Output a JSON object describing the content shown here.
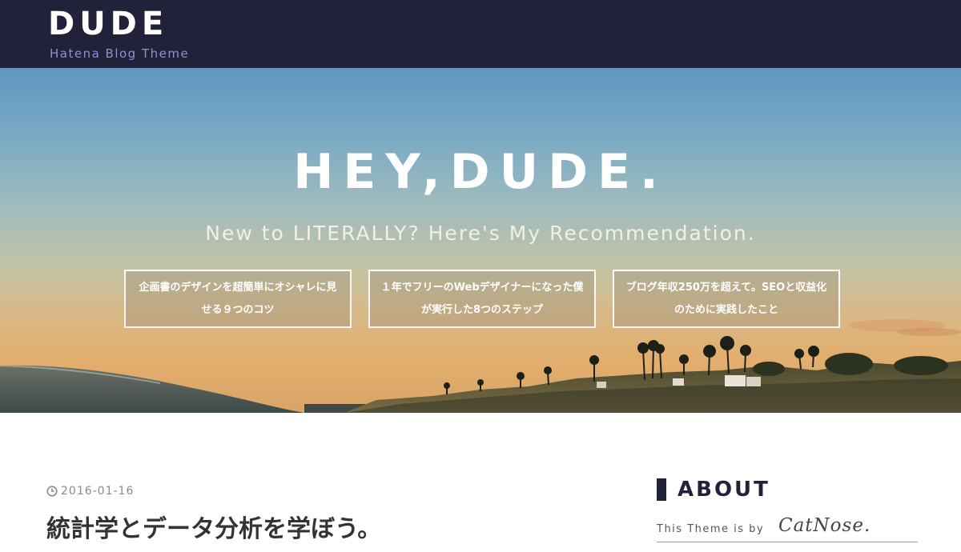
{
  "header": {
    "title": "DUDE",
    "subtitle": "Hatena Blog Theme"
  },
  "hero": {
    "title": "HEY,DUDE.",
    "subtitle": "New to LITERALLY? Here's My Recommendation.",
    "cards": [
      {
        "label": "企画書のデザインを超簡単にオシャレに見せる９つのコツ"
      },
      {
        "label": "１年でフリーのWebデザイナーになった僕が実行した8つのステップ"
      },
      {
        "label": "ブログ年収250万を超えて。SEOと収益化のために実践したこと"
      }
    ]
  },
  "post": {
    "date": "2016-01-16",
    "date_icon": "clock-icon",
    "title": "統計学とデータ分析を学ぼう。"
  },
  "sidebar": {
    "about_title": "ABOUT",
    "credit_text": "This Theme is by",
    "credit_author": "CatNose."
  },
  "colors": {
    "header_bg": "#22213a",
    "subtitle": "#8c92d4",
    "accent_bar": "#22213a"
  }
}
